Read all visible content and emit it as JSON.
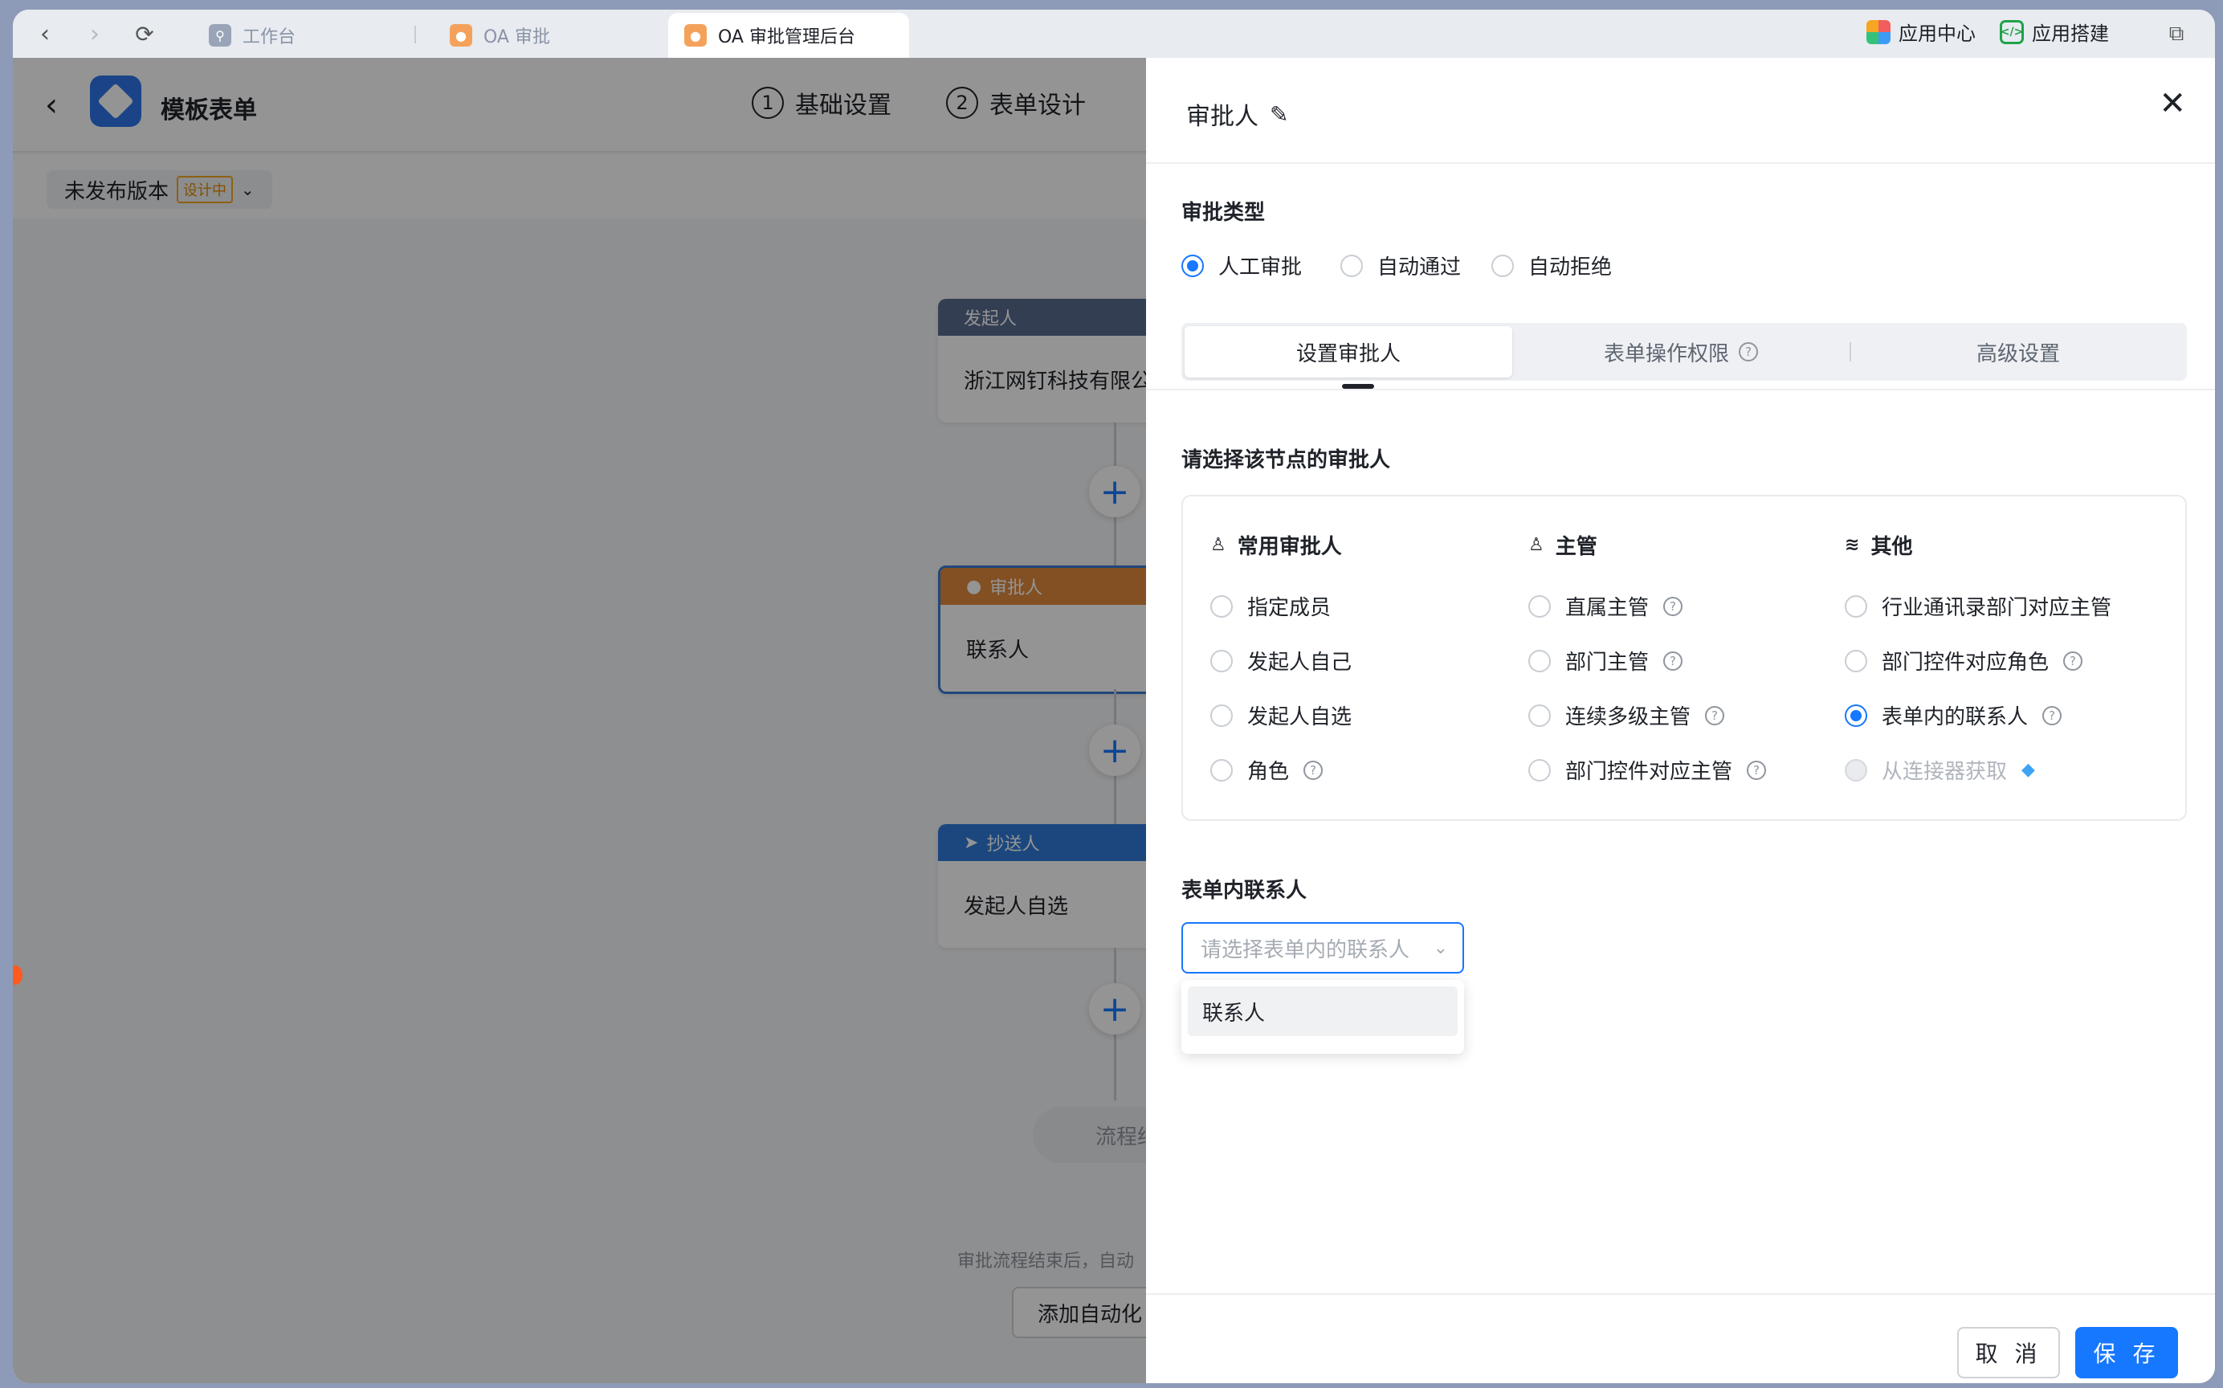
{
  "browser": {
    "tabs": [
      {
        "label": "工作台"
      },
      {
        "label": "OA 审批"
      },
      {
        "label": "OA 审批管理后台"
      }
    ],
    "app_center": "应用中心",
    "app_build": "应用搭建"
  },
  "header": {
    "title": "模板表单",
    "steps": [
      {
        "num": "1",
        "label": "基础设置"
      },
      {
        "num": "2",
        "label": "表单设计"
      }
    ]
  },
  "version": {
    "label": "未发布版本",
    "badge": "设计中"
  },
  "flow": {
    "nodes": [
      {
        "type": "发起人",
        "value": "浙江网钉科技有限公"
      },
      {
        "type": "审批人",
        "value": "联系人"
      },
      {
        "type": "抄送人",
        "value": "发起人自选"
      }
    ],
    "end_label": "流程结束",
    "footer_note": "审批流程结束后，自动",
    "auto_button": "添加自动化"
  },
  "drawer": {
    "title": "审批人",
    "approval_type_label": "审批类型",
    "approval_types": [
      {
        "label": "人工审批",
        "selected": true
      },
      {
        "label": "自动通过",
        "selected": false
      },
      {
        "label": "自动拒绝",
        "selected": false
      }
    ],
    "tabs": [
      {
        "label": "设置审批人",
        "active": true
      },
      {
        "label": "表单操作权限",
        "active": false
      },
      {
        "label": "高级设置",
        "active": false
      }
    ],
    "choose_label": "请选择该节点的审批人",
    "groups": [
      {
        "title": "常用审批人",
        "options": [
          {
            "label": "指定成员"
          },
          {
            "label": "发起人自己"
          },
          {
            "label": "发起人自选"
          },
          {
            "label": "角色",
            "help": true
          }
        ]
      },
      {
        "title": "主管",
        "options": [
          {
            "label": "直属主管",
            "help": true
          },
          {
            "label": "部门主管",
            "help": true
          },
          {
            "label": "连续多级主管",
            "help": true
          },
          {
            "label": "部门控件对应主管",
            "help": true
          }
        ]
      },
      {
        "title": "其他",
        "options": [
          {
            "label": "行业通讯录部门对应主管"
          },
          {
            "label": "部门控件对应角色",
            "help": true
          },
          {
            "label": "表单内的联系人",
            "help": true,
            "selected": true
          },
          {
            "label": "从连接器获取",
            "disabled": true
          }
        ]
      }
    ],
    "contact_label": "表单内联系人",
    "select_placeholder": "请选择表单内的联系人",
    "dropdown_options": [
      "联系人"
    ],
    "cancel": "取 消",
    "save": "保 存"
  },
  "colors": {
    "primary": "#1677ff",
    "starter": "#5b6b8f",
    "approver": "#e08a3c",
    "cc": "#2f7bd9"
  }
}
